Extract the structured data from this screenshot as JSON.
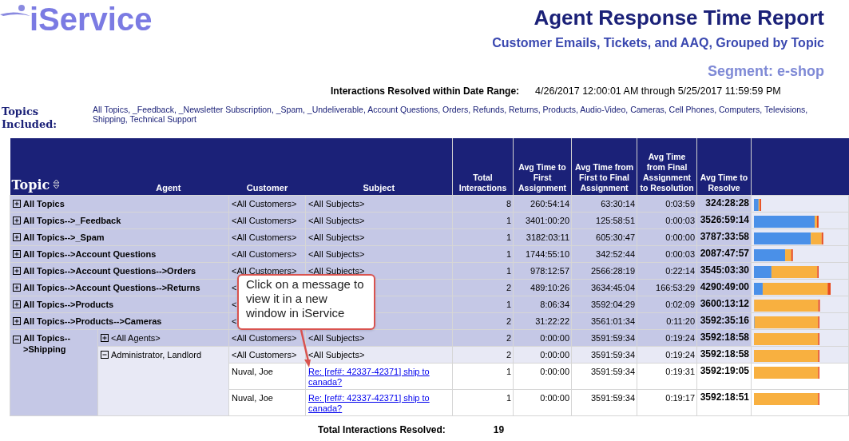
{
  "logo": {
    "text": "iService"
  },
  "header": {
    "title": "Agent Response Time Report",
    "subtitle": "Customer Emails, Tickets, and AAQ, Grouped by Topic",
    "segment": "Segment: e-shop",
    "date_label": "Interactions Resolved within Date Range:",
    "date_range": "4/26/2017 12:00:01 AM through 5/25/2017 11:59:59 PM",
    "topics_label": "Topics Included:",
    "topics_list": "All Topics, _Feedback, _Newsletter Subscription, _Spam, _Undeliverable, Account Questions, Orders, Refunds, Returns, Products, Audio-Video, Cameras, Cell Phones, Computers, Televisions, Shipping, Technical Support"
  },
  "table": {
    "columns": [
      "Topic",
      "Agent",
      "Customer",
      "Subject",
      "Total Interactions",
      "Avg Time to First Assignment",
      "Avg Time from First to Final Assignment",
      "Avg Time from Final Assignment to Resolution",
      "Avg Time to Resolve"
    ],
    "rows": [
      {
        "topic": "All Topics",
        "expanded": false,
        "customer": "<All Customers>",
        "subject": "<All Subjects>",
        "total": "8",
        "first": "260:54:14",
        "first_to_final": "63:30:14",
        "final_to_resolution": "0:03:59",
        "resolve": "324:28:28"
      },
      {
        "topic": "All Topics-->_Feedback",
        "expanded": false,
        "customer": "<All Customers>",
        "subject": "<All Subjects>",
        "total": "1",
        "first": "3401:00:20",
        "first_to_final": "125:58:51",
        "final_to_resolution": "0:00:03",
        "resolve": "3526:59:14"
      },
      {
        "topic": "All Topics-->_Spam",
        "expanded": false,
        "customer": "<All Customers>",
        "subject": "<All Subjects>",
        "total": "1",
        "first": "3182:03:11",
        "first_to_final": "605:30:47",
        "final_to_resolution": "0:00:00",
        "resolve": "3787:33:58"
      },
      {
        "topic": "All Topics-->Account Questions",
        "expanded": false,
        "customer": "<All Customers>",
        "subject": "<All Subjects>",
        "total": "1",
        "first": "1744:55:10",
        "first_to_final": "342:52:44",
        "final_to_resolution": "0:00:03",
        "resolve": "2087:47:57"
      },
      {
        "topic": "All Topics-->Account Questions-->Orders",
        "expanded": false,
        "customer": "<All Customers>",
        "subject": "<All Subjects>",
        "total": "1",
        "first": "978:12:57",
        "first_to_final": "2566:28:19",
        "final_to_resolution": "0:22:14",
        "resolve": "3545:03:30"
      },
      {
        "topic": "All Topics-->Account Questions-->Returns",
        "expanded": false,
        "customer": "<",
        "total": "2",
        "first": "489:10:26",
        "first_to_final": "3634:45:04",
        "final_to_resolution": "166:53:29",
        "resolve": "4290:49:00"
      },
      {
        "topic": "All Topics-->Products",
        "expanded": false,
        "customer": "<",
        "total": "1",
        "first": "8:06:34",
        "first_to_final": "3592:04:29",
        "final_to_resolution": "0:02:09",
        "resolve": "3600:13:12"
      },
      {
        "topic": "All Topics-->Products-->Cameras",
        "expanded": false,
        "customer": "<",
        "total": "2",
        "first": "31:22:22",
        "first_to_final": "3561:01:34",
        "final_to_resolution": "0:11:20",
        "resolve": "3592:35:16"
      },
      {
        "topic": "All Topics-->Shipping",
        "expanded": true,
        "agents": [
          {
            "agent": "<All Agents>",
            "expanded": false,
            "customer": "<All Customers>",
            "subject": "<All Subjects>",
            "total": "2",
            "first": "0:00:00",
            "first_to_final": "3591:59:34",
            "final_to_resolution": "0:19:24",
            "resolve": "3592:18:58"
          },
          {
            "agent": "Administrator, Landlord",
            "expanded": true,
            "customer": "<All Customers>",
            "subject": "<All Subjects>",
            "total": "2",
            "first": "0:00:00",
            "first_to_final": "3591:59:34",
            "final_to_resolution": "0:19:24",
            "resolve": "3592:18:58",
            "messages": [
              {
                "customer": "Nuval, Joe",
                "subject": "Re: [ref#: 42337-42371] ship to canada?",
                "total": "1",
                "first": "0:00:00",
                "first_to_final": "3591:59:34",
                "final_to_resolution": "0:19:31",
                "resolve": "3592:19:05"
              },
              {
                "customer": "Nuval, Joe",
                "subject": "Re: [ref#: 42337-42371] ship to canada?",
                "total": "1",
                "first": "0:00:00",
                "first_to_final": "3591:59:34",
                "final_to_resolution": "0:19:17",
                "resolve": "3592:18:51"
              }
            ]
          }
        ]
      }
    ]
  },
  "footer": {
    "label": "Total Interactions Resolved:",
    "value": "19"
  },
  "callout": {
    "text": "Click on a message to view it in a new window in iService"
  }
}
